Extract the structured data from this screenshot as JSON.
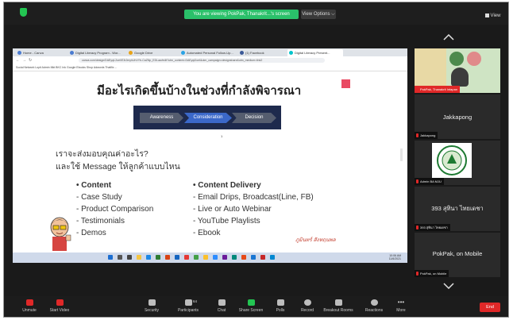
{
  "topbar": {
    "viewing_text": "You are viewing PokPak, Thanakrit...'s screen",
    "view_options": "View Options ⌵",
    "view_label": "View"
  },
  "browser": {
    "tabs": [
      "Home - Canva",
      "Digital Literacy Program - Wor...",
      "Google Drive",
      "Automated Personal Follow-Up...",
      "(1) Facebook",
      "Digital Literacy Present...",
      ""
    ],
    "active_tab_index": 5,
    "url": "canva.com/design/DAEyqt-2oeI/E3r2myhUhVYb-CaZNp_EDLaw/edit?utm_content=DAEyqt2oeI&utm_campaign=designshare&utm_medium=link2",
    "bookmarks": "Social Network   Lopit   Admin   Mkt   BKC   Ink   Google   Ebooks   Shop   Adwords   Thaiflix   ..."
  },
  "slide": {
    "title": "มีอะไรเกิดขึ้นบ้างในช่วงที่กำลังพิจารณา",
    "funnel": [
      "Awareness",
      "Consideration",
      "Decision"
    ],
    "slide_number": "1",
    "question1": "เราจะส่งมอบคุณค่าอะไร?",
    "question2": "และใช้ Message ให้ลูกค้าแบบไหน",
    "content": {
      "heading": "• Content",
      "items": [
        "- Case Study",
        "- Product Comparison",
        "- Testimonials",
        "- Demos"
      ]
    },
    "delivery": {
      "heading": "• Content Delivery",
      "items": [
        "- Email Drips, Broadcast(Line, FB)",
        "- Live or Auto Webinar",
        "- YouTube Playlists",
        "- Ebook"
      ]
    },
    "signature": "ภูมินทร์ สังหฤนพล"
  },
  "taskbar": {
    "time": "10:06 AM",
    "date": "11/6/2021"
  },
  "participants": [
    {
      "name": "",
      "label": "PokPak, Thanakrit Intapan"
    },
    {
      "name": "Jakkapong",
      "label": "Jakkapong"
    },
    {
      "name": "",
      "label": "Admin BA MJU"
    },
    {
      "name": "393 สุทินา ไทยเดชา",
      "label": "393 สุทินา ไทยเดชา"
    },
    {
      "name": "PokPak, on Mobile",
      "label": "PokPak, on Mobile"
    }
  ],
  "toolbar": {
    "unmute": "Unmute",
    "start_video": "Start Video",
    "security": "Security",
    "participants": "Participants",
    "participants_count": "64",
    "chat": "Chat",
    "share_screen": "Share Screen",
    "polls": "Polls",
    "record": "Record",
    "breakout": "Breakout Rooms",
    "reactions": "Reactions",
    "more": "More",
    "end": "End"
  },
  "colors": {
    "accent_green": "#2ac06a",
    "end_red": "#e02828",
    "slide_blue": "#3b68c9",
    "slide_navy": "#1e2a4d"
  }
}
